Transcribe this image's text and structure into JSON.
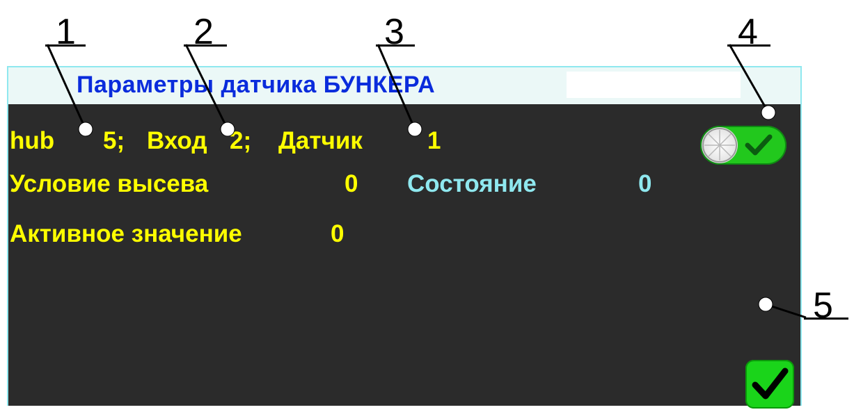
{
  "callouts": [
    "1",
    "2",
    "3",
    "4",
    "5"
  ],
  "screen": {
    "title": "Параметры датчика БУНКЕРА",
    "hub_label": "hub",
    "hub_value": "5;",
    "input_label": "Вход",
    "input_value": "2;",
    "sensor_label": "Датчик",
    "sensor_value": "1",
    "seeding_condition_label": "Условие высева",
    "seeding_condition_value": "0",
    "state_label": "Состояние",
    "state_value": "0",
    "active_value_label": "Активное значение",
    "active_value": "0",
    "toggle_state": "on"
  },
  "colors": {
    "background": "#2b2b2b",
    "title_text": "#0a2cdc",
    "label_yellow": "#ffff00",
    "label_cyan": "#8fe8ef",
    "toggle_green": "#22c81d"
  },
  "icons": [
    "check-icon",
    "toggle-knob-icon"
  ]
}
